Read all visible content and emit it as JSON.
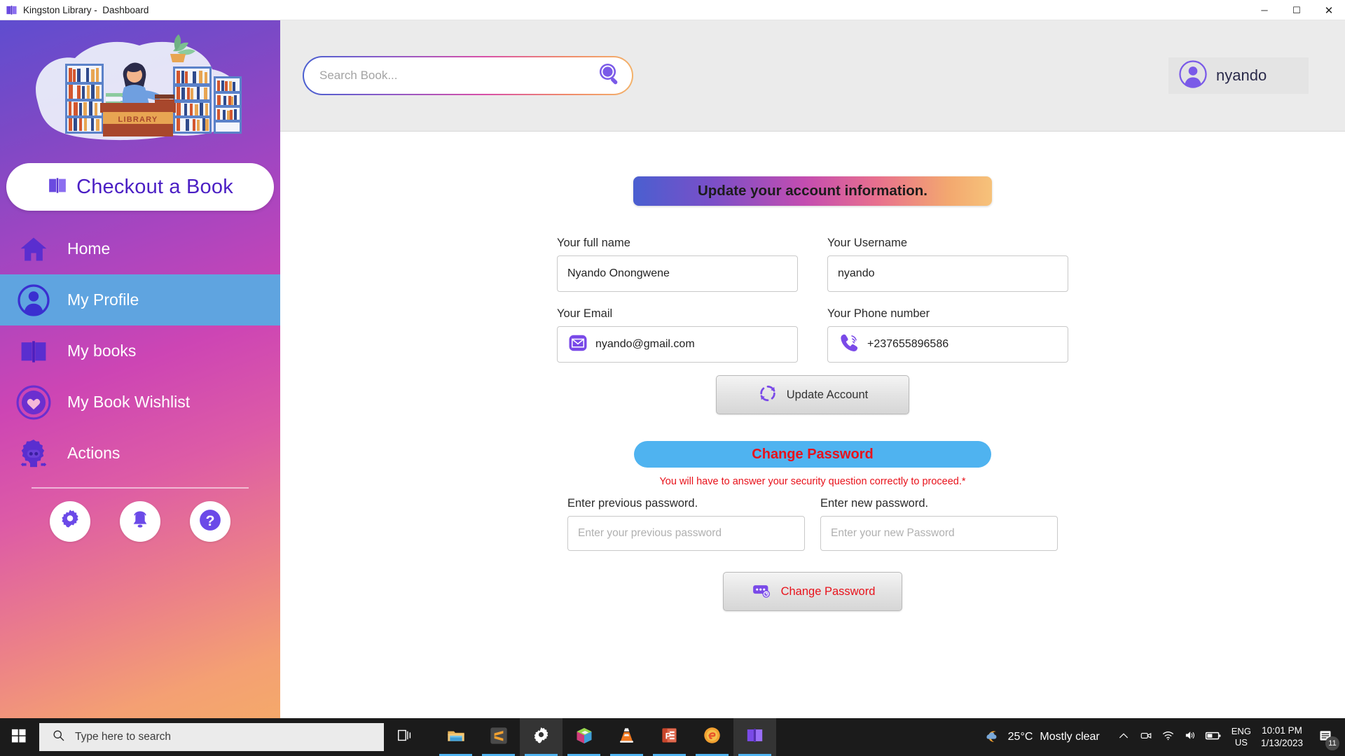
{
  "window": {
    "title": "Kingston Library -  Dashboard",
    "app_icon": "book-icon",
    "minimize": "─",
    "maximize": "☐",
    "close": "✕"
  },
  "sidebar": {
    "illustration_label": "LIBRARY",
    "checkout": {
      "label": "Checkout a Book",
      "icon": "open-book-icon"
    },
    "items": [
      {
        "label": "Home",
        "icon": "home-icon",
        "active": false
      },
      {
        "label": "My Profile",
        "icon": "user-circle-icon",
        "active": true
      },
      {
        "label": "My books",
        "icon": "open-book-icon",
        "active": false
      },
      {
        "label": "My Book Wishlist",
        "icon": "heart-circle-icon",
        "active": false
      },
      {
        "label": "Actions",
        "icon": "gear-robot-icon",
        "active": false
      }
    ],
    "tools": [
      {
        "name": "settings-icon"
      },
      {
        "name": "notifications-bell-icon"
      },
      {
        "name": "help-question-icon"
      }
    ]
  },
  "topbar": {
    "search": {
      "placeholder": "Search Book...",
      "value": "",
      "icon": "magnifier-icon"
    },
    "user": {
      "name": "nyando",
      "avatar": "avatar-icon"
    }
  },
  "main": {
    "banner": "Update your account information.",
    "fields": {
      "full_name": {
        "label": "Your full name",
        "value": "Nyando Onongwene"
      },
      "username": {
        "label": "Your Username",
        "value": "nyando"
      },
      "email": {
        "label": "Your Email",
        "value": "nyando@gmail.com",
        "icon": "envelope-icon"
      },
      "phone": {
        "label": "Your Phone number",
        "value": "+237655896586",
        "icon": "phone-icon"
      }
    },
    "update_button": {
      "label": "Update Account",
      "icon": "refresh-icon"
    },
    "change_password_banner": "Change Password",
    "warning": "You will have to answer your security question correctly to proceed.*",
    "password_fields": {
      "previous": {
        "label": "Enter previous password.",
        "placeholder": "Enter your previous password",
        "value": ""
      },
      "new": {
        "label": "Enter new password.",
        "placeholder": "Enter your new Password",
        "value": ""
      }
    },
    "change_password_button": {
      "label": "Change Password",
      "icon": "password-reset-icon"
    }
  },
  "taskbar": {
    "start_icon": "windows-start-icon",
    "search": {
      "placeholder": "Type here to search",
      "icon": "search-icon"
    },
    "task_view_icon": "task-view-icon",
    "apps": [
      {
        "name": "file-explorer-icon"
      },
      {
        "name": "sublime-text-icon"
      },
      {
        "name": "settings-icon"
      },
      {
        "name": "3d-viewer-icon"
      },
      {
        "name": "vlc-media-player-icon"
      },
      {
        "name": "powerpoint-icon"
      },
      {
        "name": "scratch-icon"
      },
      {
        "name": "kingston-library-icon"
      }
    ],
    "tray": {
      "weather": {
        "temperature": "25°C",
        "condition": "Mostly clear",
        "icon": "partly-cloudy-icon"
      },
      "chevron_icon": "chevron-up-icon",
      "meet_icon": "meet-now-icon",
      "network_icon": "wifi-icon",
      "volume_icon": "speaker-icon",
      "battery_icon": "battery-icon",
      "language": {
        "line1": "ENG",
        "line2": "US"
      },
      "time": "10:01 PM",
      "date": "1/13/2023",
      "notification_count": "11",
      "notification_icon": "action-center-icon"
    }
  }
}
